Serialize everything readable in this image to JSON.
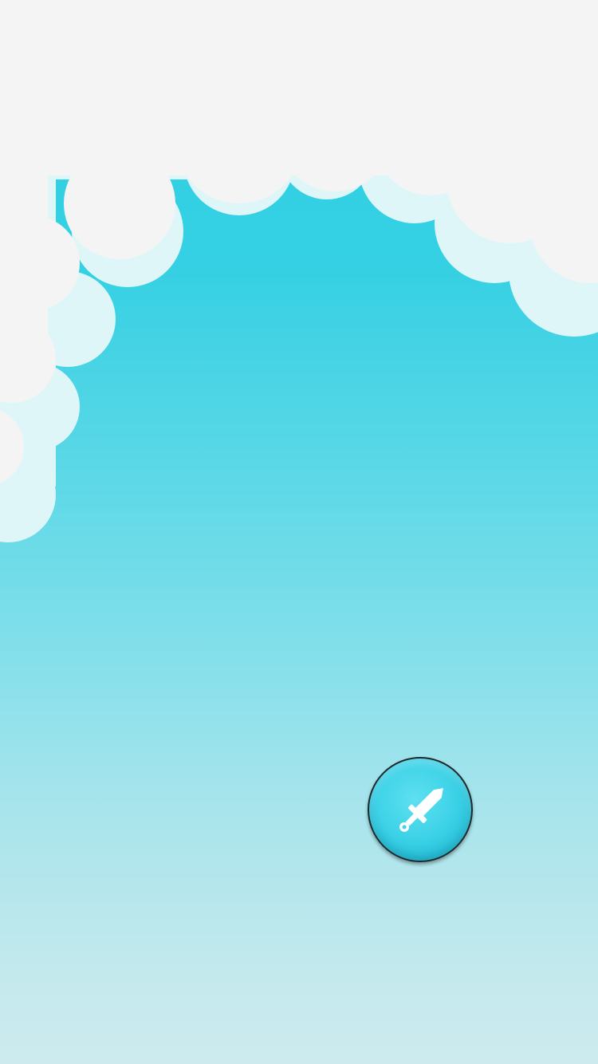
{
  "scene": {
    "name": "sky-scene",
    "colors": {
      "sky_top": "#2dcfe2",
      "sky_bottom": "#cdebee",
      "cloud_outer": "#f4f4f4",
      "cloud_inner": "#dff6f9",
      "button_fill": "#3fd3e8",
      "button_border": "#1f2a2c",
      "icon": "#ffffff"
    }
  },
  "controls": {
    "attack_button": {
      "icon": "sword-icon"
    }
  }
}
